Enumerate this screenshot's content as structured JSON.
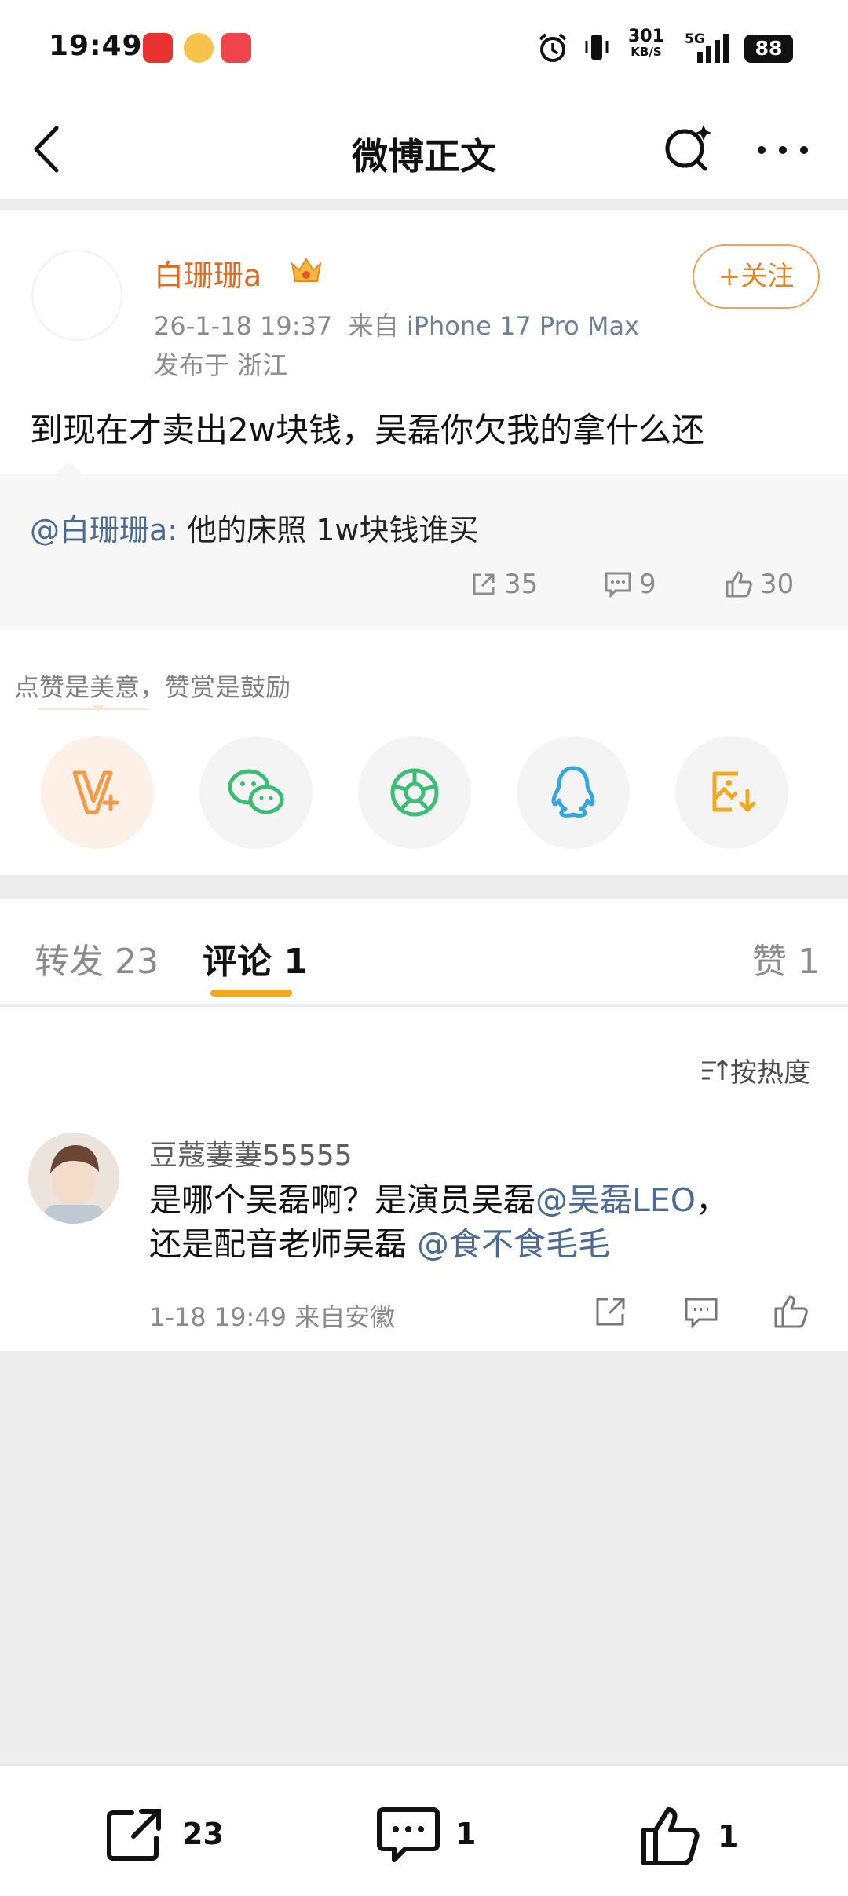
{
  "status_bar": {
    "time": "19:49",
    "speed_value": "301",
    "speed_unit": "KB/S",
    "network": "5G",
    "battery": "88"
  },
  "nav": {
    "title": "微博正文"
  },
  "post": {
    "username": "白珊珊a",
    "timestamp": "26-1-18 19:37",
    "source_prefix": "来自",
    "source_device": "iPhone 17 Pro Max",
    "location": "发布于 浙江",
    "follow_label": "+关注",
    "body": "到现在才卖出2w块钱，吴磊你欠我的拿什么还"
  },
  "quote": {
    "mention": "@白珊珊a:",
    "text": " 他的床照 1w块钱谁买",
    "reposts": "35",
    "comments": "9",
    "likes": "30"
  },
  "reward": {
    "text": "点赞是美意，赞赏是鼓励",
    "share_targets": [
      "reward-v-icon",
      "wechat-icon",
      "moments-icon",
      "qq-icon",
      "save-image-icon"
    ]
  },
  "tabs": [
    {
      "label": "转发 23"
    },
    {
      "label": "评论 1"
    },
    {
      "label": "赞 1"
    }
  ],
  "comments": {
    "sort_label": "按热度",
    "items": [
      {
        "username": "豆蔻萋萋55555",
        "text_1": "是哪个吴磊啊？是演员吴磊",
        "mention_1": "@吴磊LEO",
        "text_2": "，",
        "text_3": "还是配音老师吴磊 ",
        "mention_2": "@食不食毛毛",
        "meta": "1-18 19:49  来自安徽"
      }
    ]
  },
  "bottom_bar": {
    "reposts": "23",
    "comments": "1",
    "likes": "1"
  },
  "colors": {
    "accent_orange": "#e06a1f",
    "link_blue": "#4a6b95",
    "tab_indicator": "#f2a91e"
  }
}
